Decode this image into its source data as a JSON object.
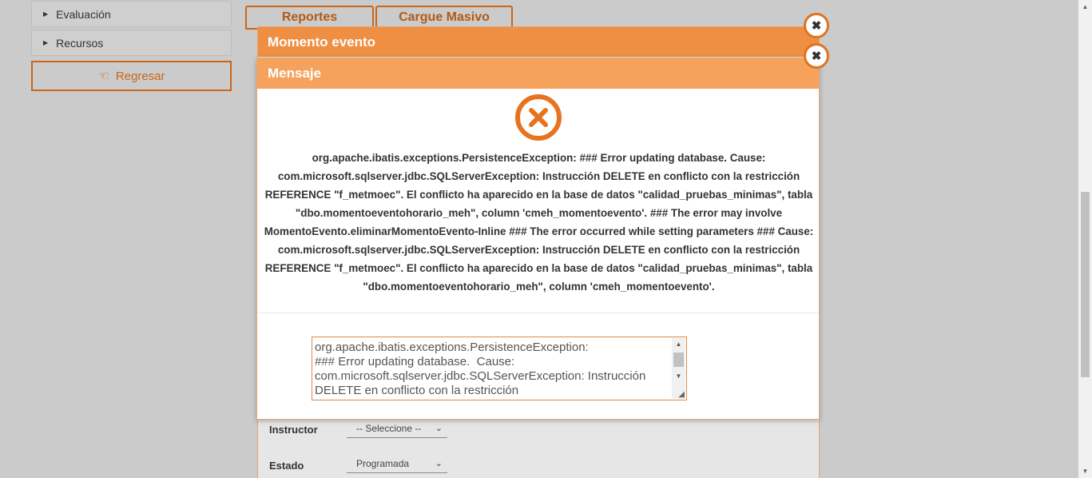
{
  "sidebar": {
    "items": [
      {
        "label": "Evaluación"
      },
      {
        "label": "Recursos"
      }
    ],
    "back_label": "Regresar"
  },
  "tabs": [
    {
      "label": "Reportes"
    },
    {
      "label": "Cargue Masivo"
    }
  ],
  "event_dialog": {
    "title": "Momento evento",
    "fields": [
      {
        "label": "Instructor",
        "value": "-- Seleccione --"
      },
      {
        "label": "Estado",
        "value": "Programada"
      }
    ]
  },
  "message_dialog": {
    "title": "Mensaje",
    "icon": "error-circle-icon",
    "message": "org.apache.ibatis.exceptions.PersistenceException: ### Error updating database. Cause: com.microsoft.sqlserver.jdbc.SQLServerException: Instrucción DELETE en conflicto con la restricción REFERENCE \"f_metmoec\". El conflicto ha aparecido en la base de datos \"calidad_pruebas_minimas\", tabla \"dbo.momentoeventohorario_meh\", column 'cmeh_momentoevento'. ### The error may involve MomentoEvento.eliminarMomentoEvento-Inline ### The error occurred while setting parameters ### Cause: com.microsoft.sqlserver.jdbc.SQLServerException: Instrucción DELETE en conflicto con la restricción REFERENCE \"f_metmoec\". El conflicto ha aparecido en la base de datos \"calidad_pruebas_minimas\", tabla \"dbo.momentoeventohorario_meh\", column 'cmeh_momentoevento'.",
    "detail_text": "org.apache.ibatis.exceptions.PersistenceException: \n### Error updating database.  Cause: com.microsoft.sqlserver.jdbc.SQLServerException: Instrucción DELETE en conflicto con la restricción"
  },
  "colors": {
    "accent": "#e8731f",
    "header_front": "#f5a25c",
    "header_back": "#ee8f44"
  }
}
